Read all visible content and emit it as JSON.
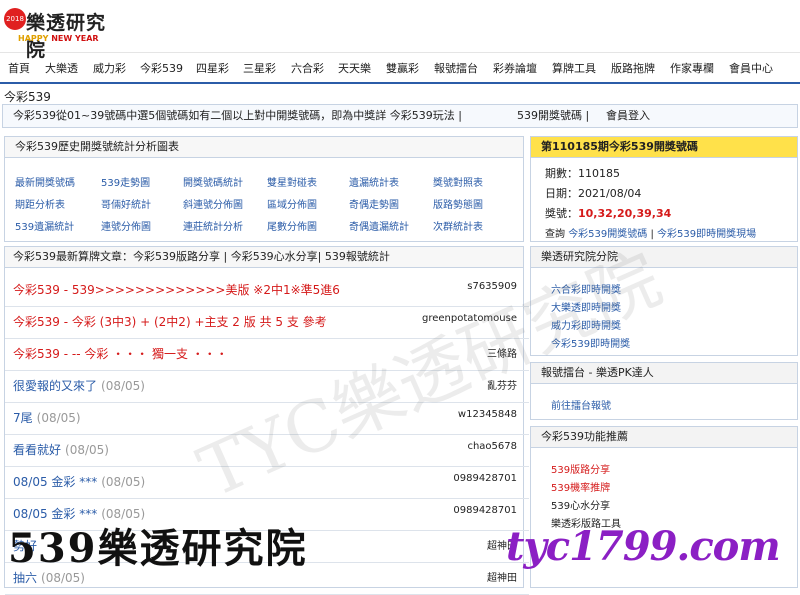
{
  "logo": {
    "year": "2018",
    "name": "樂透研究院",
    "sub_happy": "HAPPY",
    "sub_newyear": "NEW YEAR"
  },
  "nav": [
    "首頁",
    "大樂透",
    "威力彩",
    "今彩539",
    "四星彩",
    "三星彩",
    "六合彩",
    "天天樂",
    "雙贏彩",
    "報號擂台",
    "彩券論壇",
    "算牌工具",
    "版路拖牌",
    "作家專欄",
    "會員中心"
  ],
  "breadcrumb": "今彩539",
  "infobar": {
    "desc": "今彩539從01~39號碼中選5個號碼如有二個以上對中開獎號碼，即為中獎詳 今彩539玩法 |",
    "link1": "539開獎號碼 |",
    "link2": "會員登入"
  },
  "stats": {
    "title": "今彩539歷史開獎號統計分析圖表",
    "links": [
      "最新開獎號碼",
      "539走勢圖",
      "開獎號碼統計",
      "雙星對碰表",
      "遺漏統計表",
      "獎號對照表",
      "期距分析表",
      "哥倆好統計",
      "斜連號分佈圖",
      "區域分佈圖",
      "奇偶走勢圖",
      "版路勢態圖",
      "539遺漏統計",
      "連號分佈圖",
      "連莊統計分析",
      "尾數分佈圖",
      "奇偶遺漏統計",
      "次群統計表"
    ]
  },
  "draw": {
    "title": "第110185期今彩539開獎號碼",
    "period_label": "期數：",
    "period": "110185",
    "date_label": "日期：",
    "date": "2021/08/04",
    "numbers_label": "獎號：",
    "numbers": "10,32,20,39,34",
    "query_label": "查詢",
    "query_link1": "今彩539開獎號碼",
    "query_sep": "|",
    "query_link2": "今彩539即時開獎現場"
  },
  "articles": {
    "title": "今彩539最新算牌文章：今彩539版路分享 | 今彩539心水分享| 539報號統計",
    "rows": [
      {
        "title": "今彩539 - 539>>>>>>>>>>>>>美版 ※2中1※準5進6",
        "date": "",
        "author": "s7635909",
        "color": "red"
      },
      {
        "title": "今彩539 - 今彩 (3中3) + (2中2) +主支 2 版 共 5 支 參考",
        "date": "",
        "author": "greenpotatomouse",
        "color": "red"
      },
      {
        "title": "今彩539 - -- 今彩 ・・・ 獨一支 ・・・",
        "date": "",
        "author": "三條路",
        "color": "red"
      },
      {
        "title": "很愛報的又來了",
        "date": "(08/05)",
        "author": "亂芬芬",
        "color": "blue"
      },
      {
        "title": "7尾",
        "date": "(08/05)",
        "author": "w12345848",
        "color": "blue"
      },
      {
        "title": "看看就好",
        "date": "(08/05)",
        "author": "chao5678",
        "color": "blue"
      },
      {
        "title": "08/05 金彩 ***",
        "date": "(08/05)",
        "author": "0989428701",
        "color": "blue"
      },
      {
        "title": "08/05 金彩 ***",
        "date": "(08/05)",
        "author": "0989428701",
        "color": "blue"
      },
      {
        "title": "勢好",
        "date": "",
        "author": "超神田",
        "color": "blue"
      },
      {
        "title": "抽六",
        "date": "(08/05)",
        "author": "超神田",
        "color": "blue"
      }
    ]
  },
  "branch": {
    "title": "樂透研究院分院",
    "items": [
      "六合彩即時開獎",
      "大樂透即時開獎",
      "威力彩即時開獎",
      "今彩539即時開獎"
    ]
  },
  "pk": {
    "title": "報號擂台 - 樂透PK達人",
    "items": [
      "前往擂台報號"
    ]
  },
  "features": {
    "title": "今彩539功能推薦",
    "items": [
      "539版路分享",
      "539機率推牌",
      "539心水分享",
      "樂透彩版路工具"
    ]
  },
  "watermark": {
    "text": "539樂透研究院",
    "url": "tyc1799.com",
    "ghost": "TYC樂透研究院"
  },
  "colors": {
    "nav_line": "#2b5ca8",
    "link_blue": "#2b5ca8",
    "accent_red": "#d51a1a",
    "header_yellow": "#ffe14a",
    "watermark_purple": "#8b1fc4"
  }
}
